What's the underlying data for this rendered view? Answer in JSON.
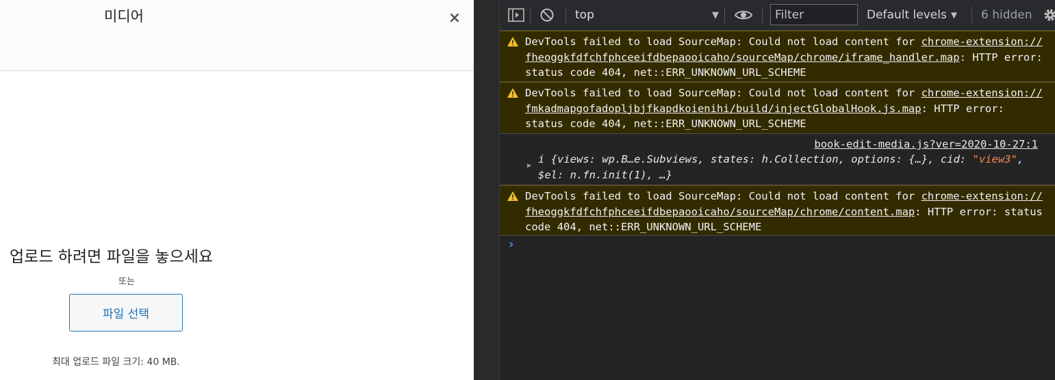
{
  "modal": {
    "title": "미디어",
    "close_symbol": "×",
    "drop_text": "업로드 하려면 파일을 놓으세요",
    "or_text": "또는",
    "select_button_label": "파일 선택",
    "max_size_text": "최대 업로드 파일 크기: 40 MB."
  },
  "toolbar": {
    "context": "top",
    "filter_placeholder": "Filter",
    "levels_label": "Default levels",
    "hidden_count": "6 hidden"
  },
  "icons": {
    "sidebar": "sidebar-toggle-icon",
    "clear": "clear-console-icon",
    "eye": "live-expression-eye-icon",
    "settings": "gear-icon",
    "warning": "warning-triangle-icon",
    "expand": "expand-triangle-icon",
    "prompt": "prompt-chevron-icon"
  },
  "colors": {
    "warning_bg": "#332b00",
    "console_bg": "#242424",
    "string_value": "#f28b54",
    "prompt": "#4d8bf5",
    "button_accent": "#2271b1"
  },
  "console": {
    "warnings": [
      {
        "prefix": "DevTools failed to load SourceMap: Could not load content for ",
        "link": "chrome-extension://fheoggkfdfchfphceeifdbepaooicaho/sourceMap/chrome/iframe_handler.map",
        "suffix": ": HTTP error: status code 404, net::ERR_UNKNOWN_URL_SCHEME"
      },
      {
        "prefix": "DevTools failed to load SourceMap: Could not load content for ",
        "link": "chrome-extension://fmkadmapgofadopljbjfkapdkoienihi/build/injectGlobalHook.js.map",
        "suffix": ": HTTP error: status code 404, net::ERR_UNKNOWN_URL_SCHEME"
      }
    ],
    "log": {
      "source": "book-edit-media.js?ver=2020-10-27:1",
      "text_before": "i {views: wp.B…e.Subviews, states: h.Collection, options: {…}, cid: ",
      "string_value": "\"view3\"",
      "text_after": ", $el: n.fn.init(1), …}"
    },
    "warning_last": {
      "prefix": "DevTools failed to load SourceMap: Could not load content for ",
      "link": "chrome-extension://fheoggkfdfchfphceeifdbepaooicaho/sourceMap/chrome/content.map",
      "suffix": ": HTTP error: status code 404, net::ERR_UNKNOWN_URL_SCHEME"
    },
    "prompt_symbol": "›"
  }
}
